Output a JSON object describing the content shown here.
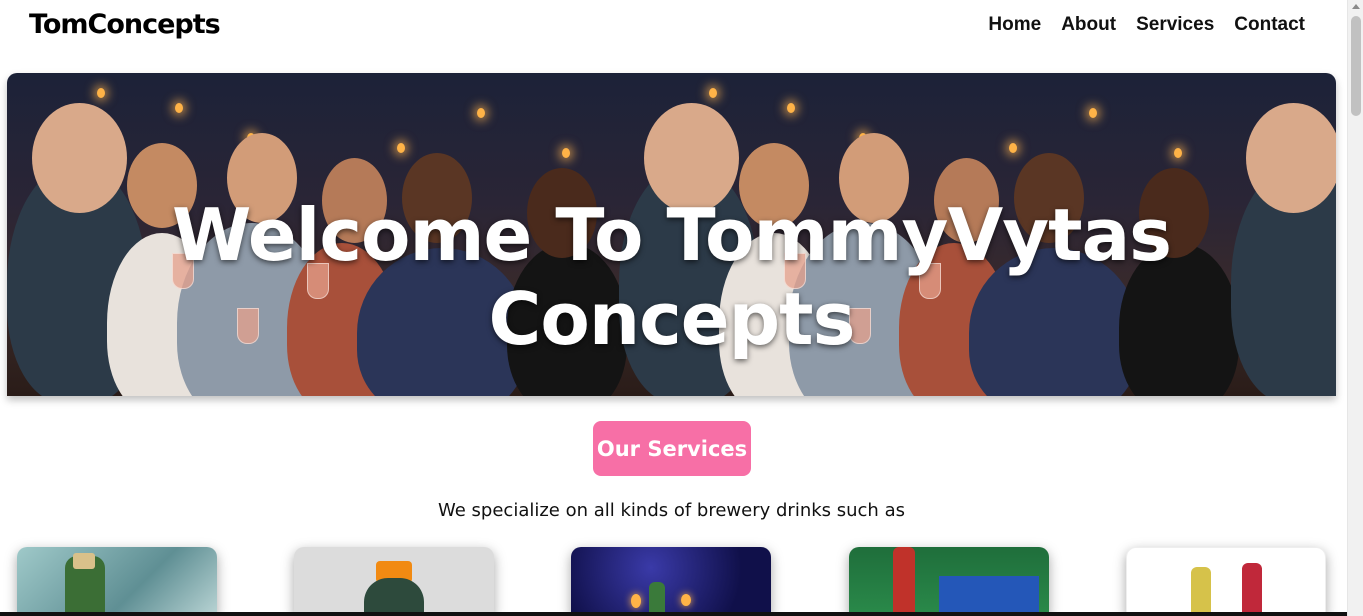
{
  "navbar": {
    "brand": "TomConcepts",
    "links": [
      "Home",
      "About",
      "Services",
      "Contact"
    ]
  },
  "hero": {
    "title": "Welcome To TommyVytas Concepts"
  },
  "services": {
    "button_label": "Our Services",
    "tagline": "We specialize on all kinds of brewery drinks such as"
  },
  "colors": {
    "accent": "#f76fa6",
    "text": "#111111"
  }
}
